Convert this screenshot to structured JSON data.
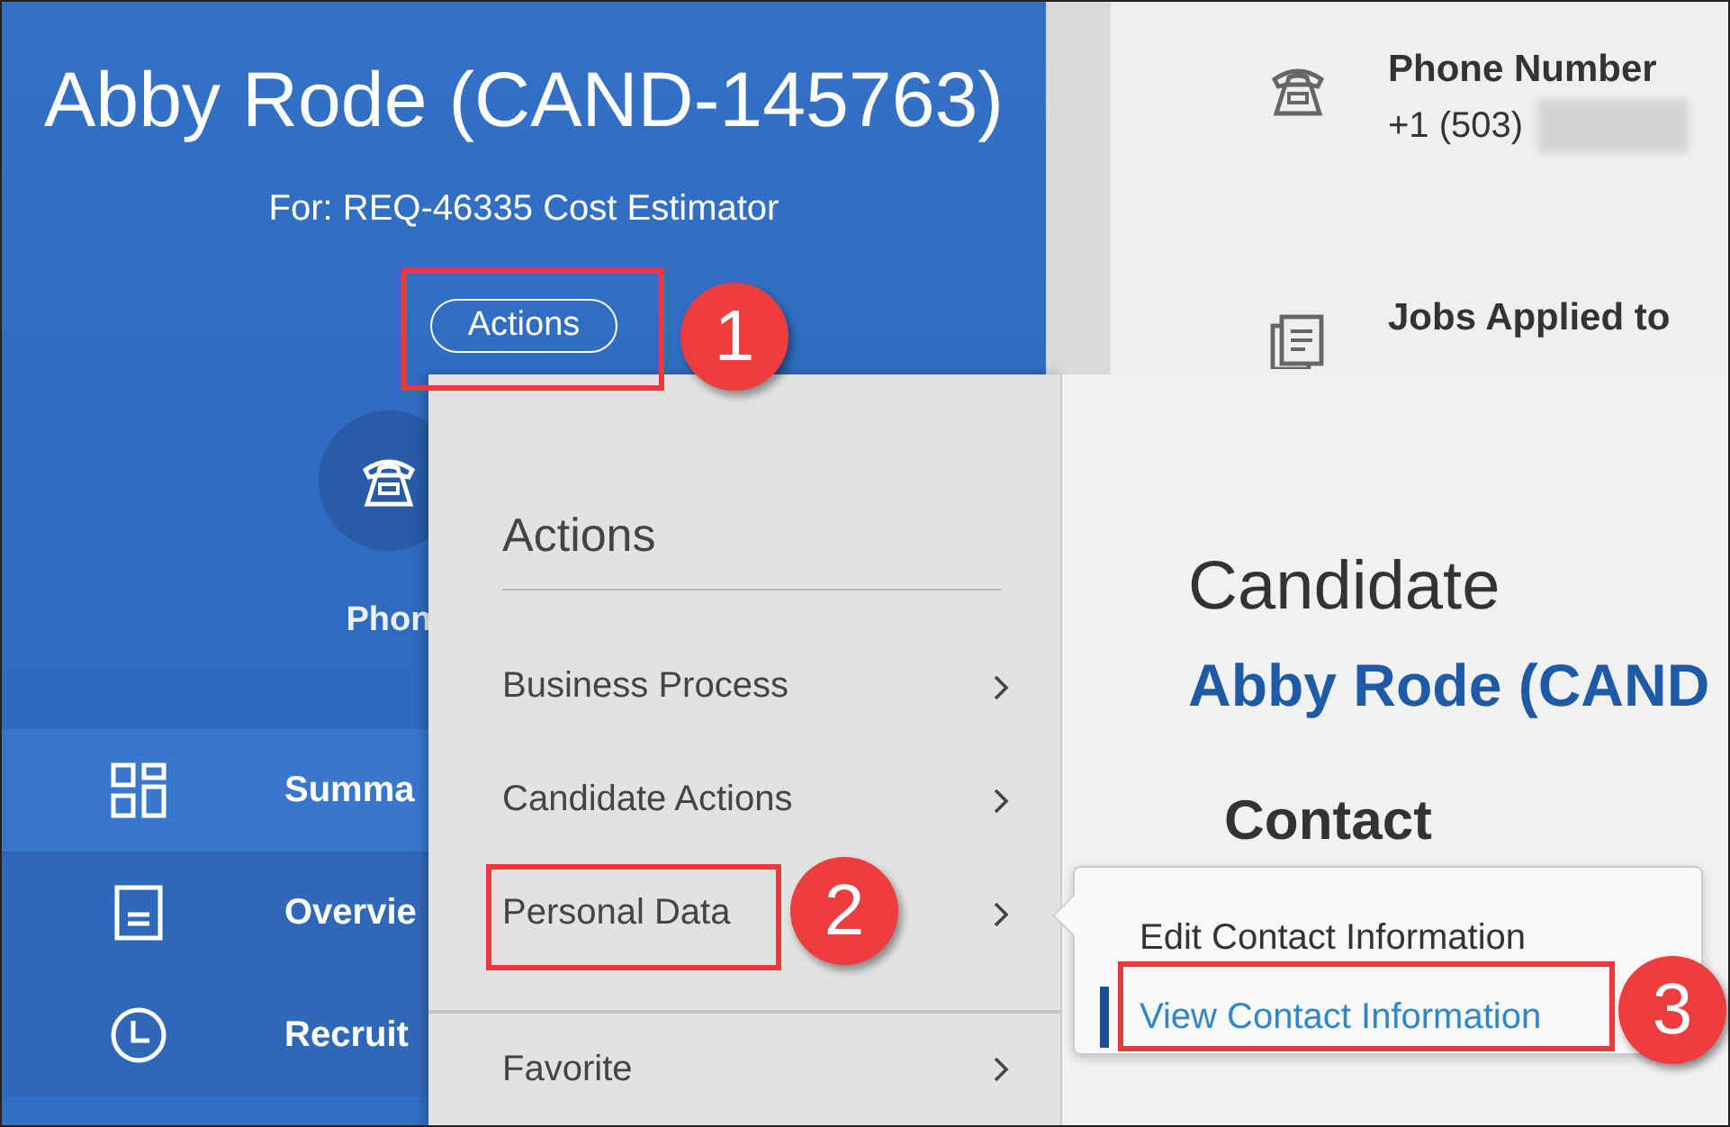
{
  "header": {
    "title": "Abby Rode (CAND-145763)",
    "subtitle": "For: REQ-46335 Cost Estimator",
    "actions_button": "Actions"
  },
  "quick_action": {
    "label": "Phon"
  },
  "nav": [
    {
      "label": "Summa",
      "kind": "grid",
      "selected": true
    },
    {
      "label": "Overvie",
      "kind": "document",
      "selected": false
    },
    {
      "label": "Recruit",
      "kind": "clock",
      "selected": false
    }
  ],
  "details": [
    {
      "kind": "phone",
      "label": "Phone Number",
      "value": "+1 (503)",
      "redacted": true
    },
    {
      "kind": "jobs",
      "label": "Jobs Applied to"
    }
  ],
  "actions_menu": {
    "title": "Actions",
    "items": [
      {
        "label": "Business Process",
        "divider_before": false
      },
      {
        "label": "Candidate Actions",
        "divider_before": false
      },
      {
        "label": "Personal Data",
        "divider_before": false
      },
      {
        "label": "Favorite",
        "divider_before": true
      }
    ]
  },
  "candidate_panel": {
    "heading": "Candidate",
    "name": "Abby Rode (CAND",
    "section": "Contact"
  },
  "submenu": {
    "items": [
      {
        "label": "Edit Contact Information",
        "selected": false
      },
      {
        "label": "View Contact Information",
        "selected": true
      }
    ]
  },
  "annotations": [
    {
      "number": "1"
    },
    {
      "number": "2"
    },
    {
      "number": "3"
    }
  ]
}
